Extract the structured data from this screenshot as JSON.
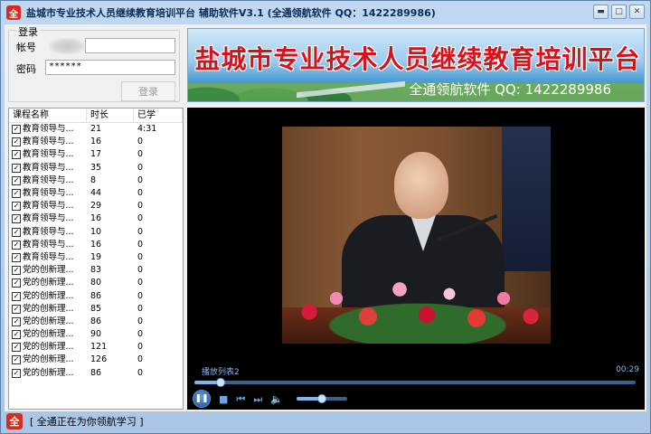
{
  "window": {
    "icon_glyph": "全",
    "title": "盐城市专业技术人员继续教育培训平台 辅助软件V3.1 (全通领航软件 QQ：1422289986)",
    "minimize_glyph": "▬",
    "maximize_glyph": "□",
    "close_glyph": "✕"
  },
  "login": {
    "legend": "登录",
    "account_label": "帐号",
    "account_value": "",
    "password_label": "密码",
    "password_value": "******",
    "login_button": "登录"
  },
  "course_list": {
    "columns": [
      "课程名称",
      "时长",
      "已学"
    ],
    "rows": [
      {
        "name": "教育领导与...",
        "duration": "21",
        "learned": "4:31",
        "checked": true
      },
      {
        "name": "教育领导与...",
        "duration": "16",
        "learned": "0",
        "checked": true
      },
      {
        "name": "教育领导与...",
        "duration": "17",
        "learned": "0",
        "checked": true
      },
      {
        "name": "教育领导与...",
        "duration": "35",
        "learned": "0",
        "checked": true
      },
      {
        "name": "教育领导与...",
        "duration": "8",
        "learned": "0",
        "checked": true
      },
      {
        "name": "教育领导与...",
        "duration": "44",
        "learned": "0",
        "checked": true
      },
      {
        "name": "教育领导与...",
        "duration": "29",
        "learned": "0",
        "checked": true
      },
      {
        "name": "教育领导与...",
        "duration": "16",
        "learned": "0",
        "checked": true
      },
      {
        "name": "教育领导与...",
        "duration": "10",
        "learned": "0",
        "checked": true
      },
      {
        "name": "教育领导与...",
        "duration": "16",
        "learned": "0",
        "checked": true
      },
      {
        "name": "教育领导与...",
        "duration": "19",
        "learned": "0",
        "checked": true
      },
      {
        "name": "党的创新理...",
        "duration": "83",
        "learned": "0",
        "checked": true
      },
      {
        "name": "党的创新理...",
        "duration": "80",
        "learned": "0",
        "checked": true
      },
      {
        "name": "党的创新理...",
        "duration": "86",
        "learned": "0",
        "checked": true
      },
      {
        "name": "党的创新理...",
        "duration": "85",
        "learned": "0",
        "checked": true
      },
      {
        "name": "党的创新理...",
        "duration": "86",
        "learned": "0",
        "checked": true
      },
      {
        "name": "党的创新理...",
        "duration": "90",
        "learned": "0",
        "checked": true
      },
      {
        "name": "党的创新理...",
        "duration": "121",
        "learned": "0",
        "checked": true
      },
      {
        "name": "党的创新理...",
        "duration": "126",
        "learned": "0",
        "checked": true
      },
      {
        "name": "党的创新理...",
        "duration": "86",
        "learned": "0",
        "checked": true
      }
    ]
  },
  "banner": {
    "title": "盐城市专业技术人员继续教育培训平台",
    "subtitle": "全通领航软件 QQ: 1422289986",
    "title_color": "#d4141c"
  },
  "player": {
    "playlist_label": "播放列表2",
    "time": "00:29",
    "seek_progress": 0.06,
    "volume_level": 0.5,
    "controls": {
      "play_pause_glyph": "❚❚",
      "stop_glyph": "■",
      "prev_glyph": "⏮",
      "next_glyph": "⏭",
      "volume_glyph": "🔈"
    },
    "accent_color": "#7fb4ef"
  },
  "status": {
    "icon_glyph": "全",
    "text": "[ 全通正在为你领航学习 ]"
  }
}
